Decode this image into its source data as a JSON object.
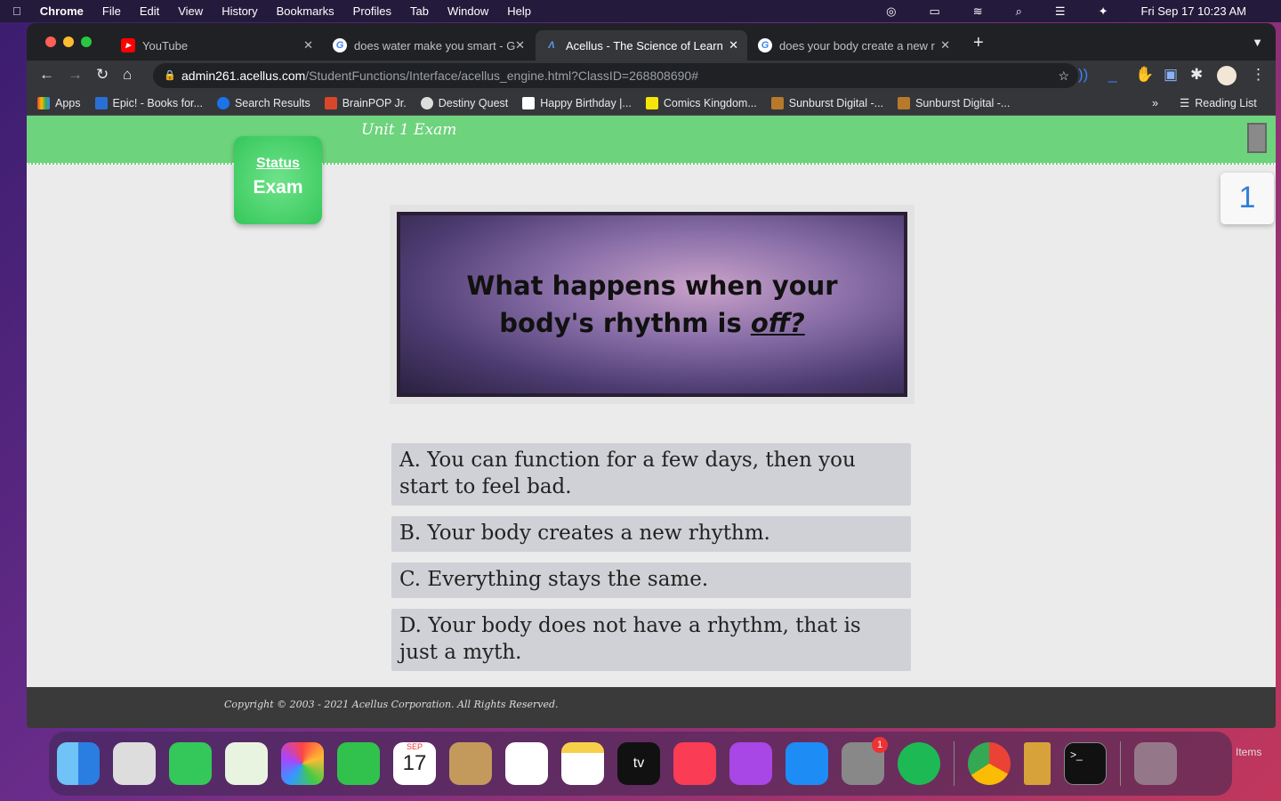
{
  "menubar": {
    "app": "Chrome",
    "items": [
      "File",
      "Edit",
      "View",
      "History",
      "Bookmarks",
      "Profiles",
      "Tab",
      "Window",
      "Help"
    ],
    "datetime": "Fri Sep 17  10:23 AM"
  },
  "tabs": [
    {
      "title": "YouTube"
    },
    {
      "title": "does water make you smart - G"
    },
    {
      "title": "Acellus - The Science of Learn"
    },
    {
      "title": "does your body create a new r"
    }
  ],
  "url": {
    "host": "admin261.acellus.com",
    "path": "/StudentFunctions/Interface/acellus_engine.html?ClassID=268808690#"
  },
  "bookmarks": [
    "Apps",
    "Epic! - Books for...",
    "Search Results",
    "BrainPOP Jr.",
    "Destiny Quest",
    "Happy Birthday |...",
    "Comics Kingdom...",
    "Sunburst Digital -...",
    "Sunburst Digital -..."
  ],
  "reading_list": "Reading List",
  "page": {
    "unit_title": "Unit 1 Exam",
    "status_label": "Status",
    "status_value": "Exam",
    "page_number": "1",
    "question_line1": "What happens when your",
    "question_line2": "body's rhythm is ",
    "question_emph": "off?",
    "answers": [
      "A.  You can function for a few days, then you start to feel bad.",
      "B.  Your body creates a new rhythm.",
      "C.  Everything stays the same.",
      "D.  Your body does not have a rhythm, that is just a myth."
    ],
    "copyright": "Copyright © 2003 - 2021 Acellus Corporation.  All Rights Reserved."
  },
  "dock": {
    "calendar_month": "SEP",
    "calendar_day": "17",
    "settings_badge": "1",
    "items_label": "Items"
  }
}
